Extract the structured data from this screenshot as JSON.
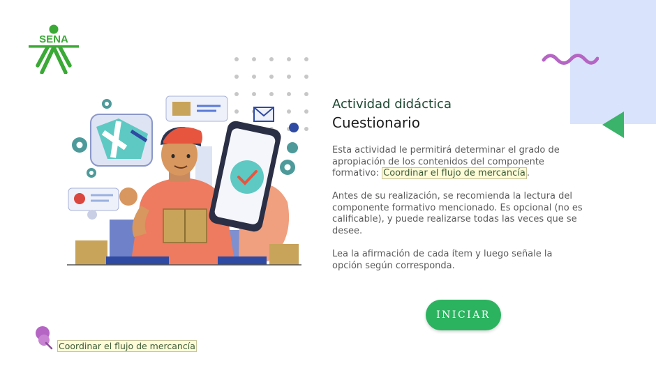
{
  "brand": {
    "logo_text": "SENA",
    "logo_color": "#3aa935"
  },
  "activity": {
    "type_label": "Actividad didáctica",
    "name": "Cuestionario"
  },
  "description": {
    "p1_text": "Esta actividad le permitirá determinar el grado de apropiación de los contenidos del componente formativo: ",
    "p1_link": "Coordinar el flujo de mercancía",
    "p1_end": ".",
    "p2": "Antes de su realización, se recomienda la lectura del componente formativo mencionado.  Es opcional (no es calificable), y puede realizarse todas las veces que se desee.",
    "p3": "Lea la afirmación de cada ítem y luego señale la opción según corresponda."
  },
  "start_button_label": "INICIAR",
  "footer": {
    "link_text": "Coordinar el flujo de mercancía"
  },
  "colors": {
    "accent_green": "#2bb35f",
    "decor_blue": "#d9e3fb",
    "wave_purple": "#b565c4",
    "triangle_green": "#3bb36a"
  }
}
